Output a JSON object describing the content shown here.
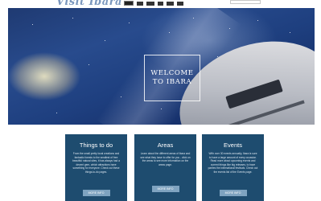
{
  "header": {
    "logo": "Visit Ibara",
    "nav_items": [
      "Home",
      "Things to do",
      "Areas",
      "Events",
      "News",
      "Contact"
    ]
  },
  "hero": {
    "welcome_text": "WELCOME\nTO IBARA"
  },
  "cards": [
    {
      "title": "Things to do",
      "text": "From the small pretty local creations and fantastic forests to the smallest of free beautiful natural sites, it has always had a decent gem, which attractions have something for everyone. Check out these things-to-do pages.",
      "button": "MORE INFO"
    },
    {
      "title": "Areas",
      "text": "Learn about the different areas of Ibara and see what they have to offer for you - click on the areas to see more information on the areas page.",
      "button": "MORE INFO"
    },
    {
      "title": "Events",
      "text": "With over 30 events annually, Ibara is sure to have a large amount of every occasion. Read more about upcoming events and current things like big releases, to have parties the international festivals. Check out the events list of the Events page.",
      "button": "MORE INFO"
    }
  ],
  "colors": {
    "card_bg": "#1e4c6f",
    "button_bg": "#7fa3c0",
    "logo": "#7b97bd"
  }
}
